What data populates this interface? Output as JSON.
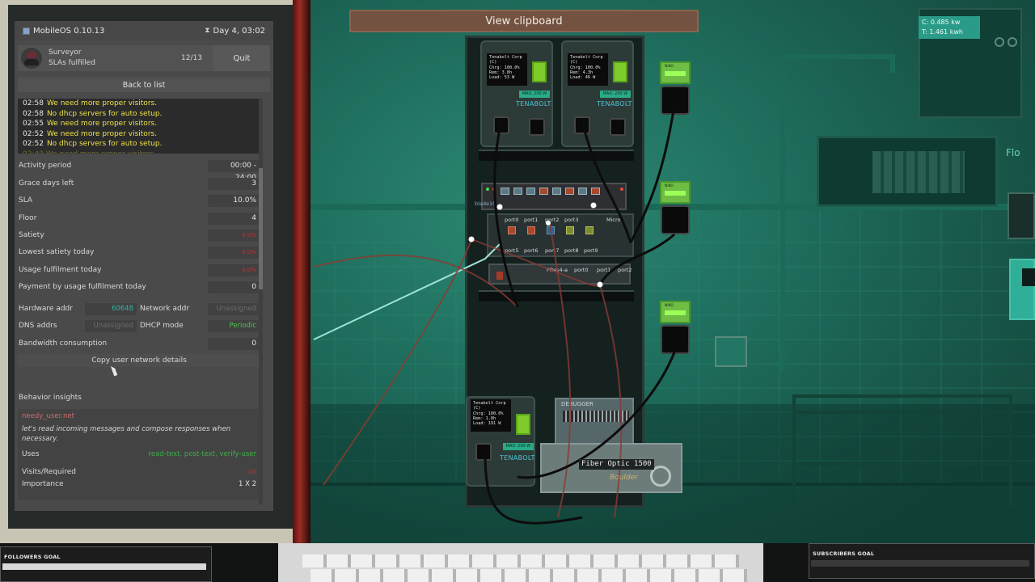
{
  "phone": {
    "os_name": "MobileOS 0.10.13",
    "day_time": "Day 4, 03:02",
    "surveyor_title": "Surveyor",
    "surveyor_subtitle": "SLAs fulfilled",
    "sla_count": "12/13",
    "quit_label": "Quit",
    "back_label": "Back to list"
  },
  "log": [
    {
      "time": "02:58",
      "text": "We need more proper visitors."
    },
    {
      "time": "02:58",
      "text": "No dhcp servers for auto setup."
    },
    {
      "time": "02:55",
      "text": "We need more proper visitors."
    },
    {
      "time": "02:52",
      "text": "We need more proper visitors."
    },
    {
      "time": "02:52",
      "text": "No dhcp servers for auto setup."
    }
  ],
  "stats": [
    {
      "label": "Activity period",
      "value": "00:00 - 24:00",
      "red": false
    },
    {
      "label": "Grace days left",
      "value": "3",
      "red": false
    },
    {
      "label": "SLA",
      "value": "10.0%",
      "red": false
    },
    {
      "label": "Floor",
      "value": "4",
      "red": false
    },
    {
      "label": "Satiety",
      "value": "0.0%",
      "red": true
    },
    {
      "label": "Lowest satiety today",
      "value": "0.0%",
      "red": true
    },
    {
      "label": "Usage fulfilment today",
      "value": "0.0%",
      "red": true
    },
    {
      "label": "Payment by usage fulfilment today",
      "value": "0",
      "red": false
    }
  ],
  "network": {
    "hw_label": "Hardware addr",
    "hw_value": "60648",
    "net_label": "Network addr",
    "net_value": "Unassigned",
    "dns_label": "DNS addrs",
    "dns_value": "Unassigned",
    "dhcp_label": "DHCP mode",
    "dhcp_value": "Periodic",
    "bw_label": "Bandwidth consumption",
    "bw_value": "0",
    "copy_label": "Copy user network details"
  },
  "insights": {
    "header": "Behavior insights",
    "host": "needy_user.net",
    "desc": "let's read incoming messages and compose responses when necessary.",
    "uses_label": "Uses",
    "uses_value": "read-text, post-text, verify-user",
    "visits_label": "Visits/Required",
    "visits_value": "0/3",
    "importance_label": "Importance",
    "importance_value": "1 X 2"
  },
  "scene": {
    "clipboard_label": "View clipboard",
    "power_c": "C: 0.485 kw",
    "power_t": "T: 1.461 kwh",
    "psu1": [
      "Tenabolt Corp",
      "(C)",
      "Chrg: 100.0%",
      "Rem: 3.8h",
      "Load: 53 W"
    ],
    "psu2": [
      "Tenabolt Corp",
      "(C)",
      "Chrg: 100.0%",
      "Rem: 4.3h",
      "Load: 46 W"
    ],
    "psu3": [
      "Tenabolt Corp",
      "(C)",
      "Chrg: 100.0%",
      "Rem: 1.0h",
      "Load: 191 W"
    ],
    "psu_max": "MAX: 200 W",
    "psu_brand": "TENABOLT",
    "switch_label": "blade10",
    "patch_labels": [
      "port0",
      "port1",
      "port2",
      "port3",
      "port4",
      "port5",
      "port6",
      "port7",
      "port8",
      "port9"
    ],
    "patch_brand": "Micro",
    "router_labels": [
      "PRes4-a",
      "port0",
      "port1",
      "port2"
    ],
    "debugger_label": "DEBUGGER",
    "router2_label": "Boulder",
    "fiber_label": "Fiber Optic 1500",
    "socket_label": "LINKED",
    "socket_brand": "NIKO",
    "right_sign": "Flo"
  },
  "overlay": {
    "followers_goal": "FOLLOWERS GOAL",
    "subscribers_goal": "SUBSCRIBERS GOAL"
  },
  "colors": {
    "warning_text": "#ede14a",
    "danger_text": "#b3383a",
    "positive_text": "#3fae48",
    "room_teal": "#217462",
    "clipboard_brown": "#735241"
  }
}
